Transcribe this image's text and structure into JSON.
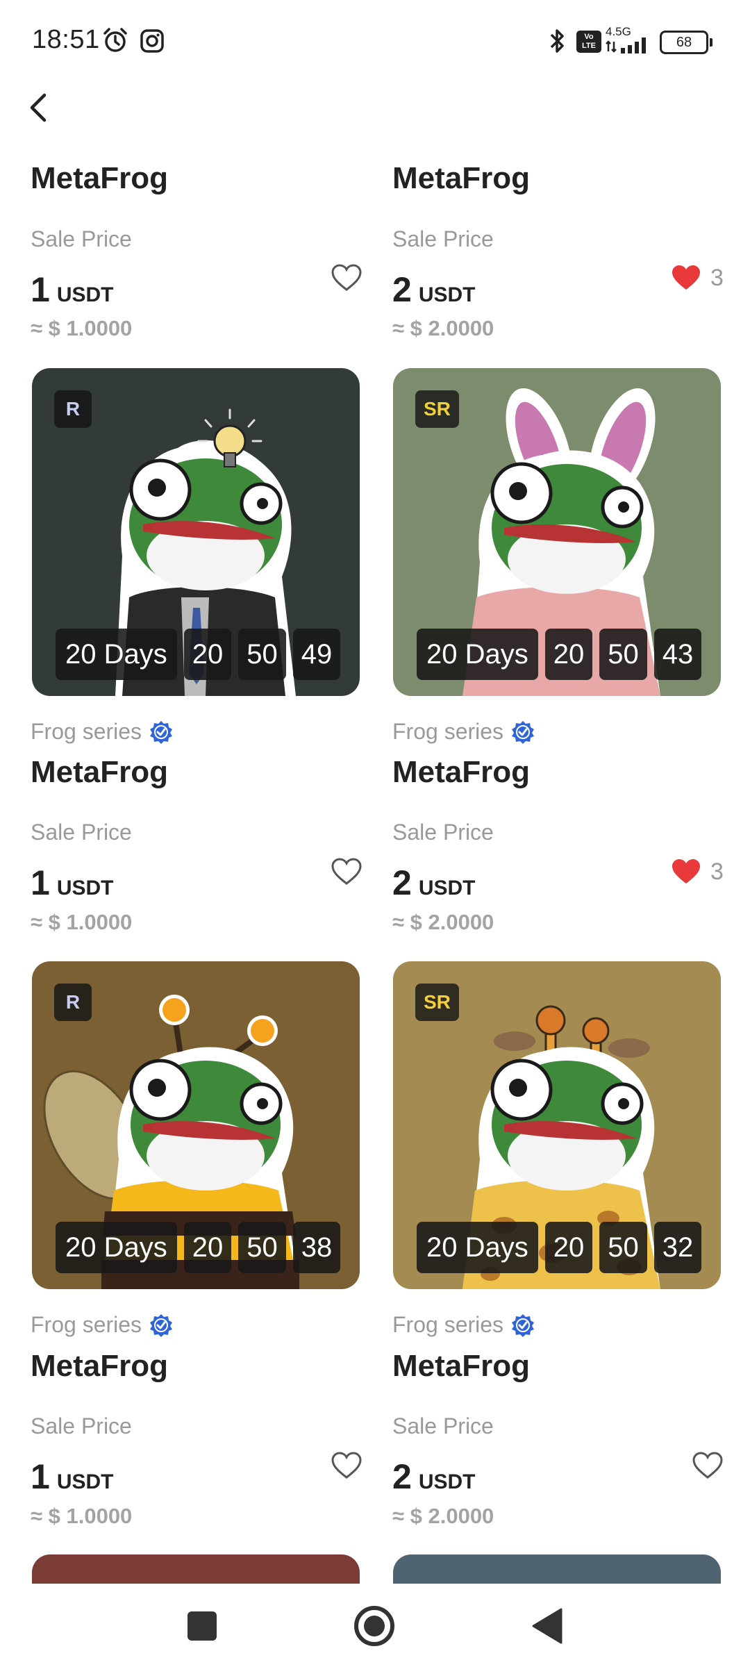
{
  "status_bar": {
    "time": "18:51",
    "network_label": "4.5G",
    "volte_label": "Vo LTE",
    "battery": "68",
    "icons": [
      "alarm-icon",
      "instagram-icon",
      "bluetooth-icon",
      "volte-icon",
      "signal-icon",
      "battery-icon"
    ]
  },
  "nav": {
    "back_icon": "chevron-left-icon"
  },
  "top_items": [
    {
      "name": "MetaFrog",
      "sale_label": "Sale Price",
      "price": "1",
      "unit": "USDT",
      "usd": "≈ $ 1.0000",
      "liked": false,
      "like_count": ""
    },
    {
      "name": "MetaFrog",
      "sale_label": "Sale Price",
      "price": "2",
      "unit": "USDT",
      "usd": "≈ $ 2.0000",
      "liked": true,
      "like_count": "3"
    }
  ],
  "items": [
    {
      "rarity": "R",
      "bg": "#333b39",
      "timer": {
        "days": "20 Days",
        "hours": "20",
        "minutes": "50",
        "seconds": "49"
      },
      "series": "Frog series",
      "name": "MetaFrog",
      "sale_label": "Sale Price",
      "price": "1",
      "unit": "USDT",
      "usd": "≈ $ 1.0000",
      "liked": false,
      "like_count": ""
    },
    {
      "rarity": "SR",
      "bg": "#7d8c6c",
      "timer": {
        "days": "20 Days",
        "hours": "20",
        "minutes": "50",
        "seconds": "43"
      },
      "series": "Frog series",
      "name": "MetaFrog",
      "sale_label": "Sale Price",
      "price": "2",
      "unit": "USDT",
      "usd": "≈ $ 2.0000",
      "liked": true,
      "like_count": "3"
    },
    {
      "rarity": "R",
      "bg": "#7a6033",
      "timer": {
        "days": "20 Days",
        "hours": "20",
        "minutes": "50",
        "seconds": "38"
      },
      "series": "Frog series",
      "name": "MetaFrog",
      "sale_label": "Sale Price",
      "price": "1",
      "unit": "USDT",
      "usd": "≈ $ 1.0000",
      "liked": false,
      "like_count": ""
    },
    {
      "rarity": "SR",
      "bg": "#a48b52",
      "timer": {
        "days": "20 Days",
        "hours": "20",
        "minutes": "50",
        "seconds": "32"
      },
      "series": "Frog series",
      "name": "MetaFrog",
      "sale_label": "Sale Price",
      "price": "2",
      "unit": "USDT",
      "usd": "≈ $ 2.0000",
      "liked": false,
      "like_count": ""
    }
  ],
  "partial_tiles": [
    {
      "bg": "#7a3c35"
    },
    {
      "bg": "#4f6370"
    }
  ],
  "colors": {
    "accent_heart": "#e83a3a",
    "verified_blue": "#2f64d8",
    "rarity_r": "#c8cdf4",
    "rarity_sr": "#f3cf3b"
  },
  "system_nav": {
    "icons": [
      "recents-square-icon",
      "home-circle-icon",
      "back-triangle-icon"
    ]
  }
}
